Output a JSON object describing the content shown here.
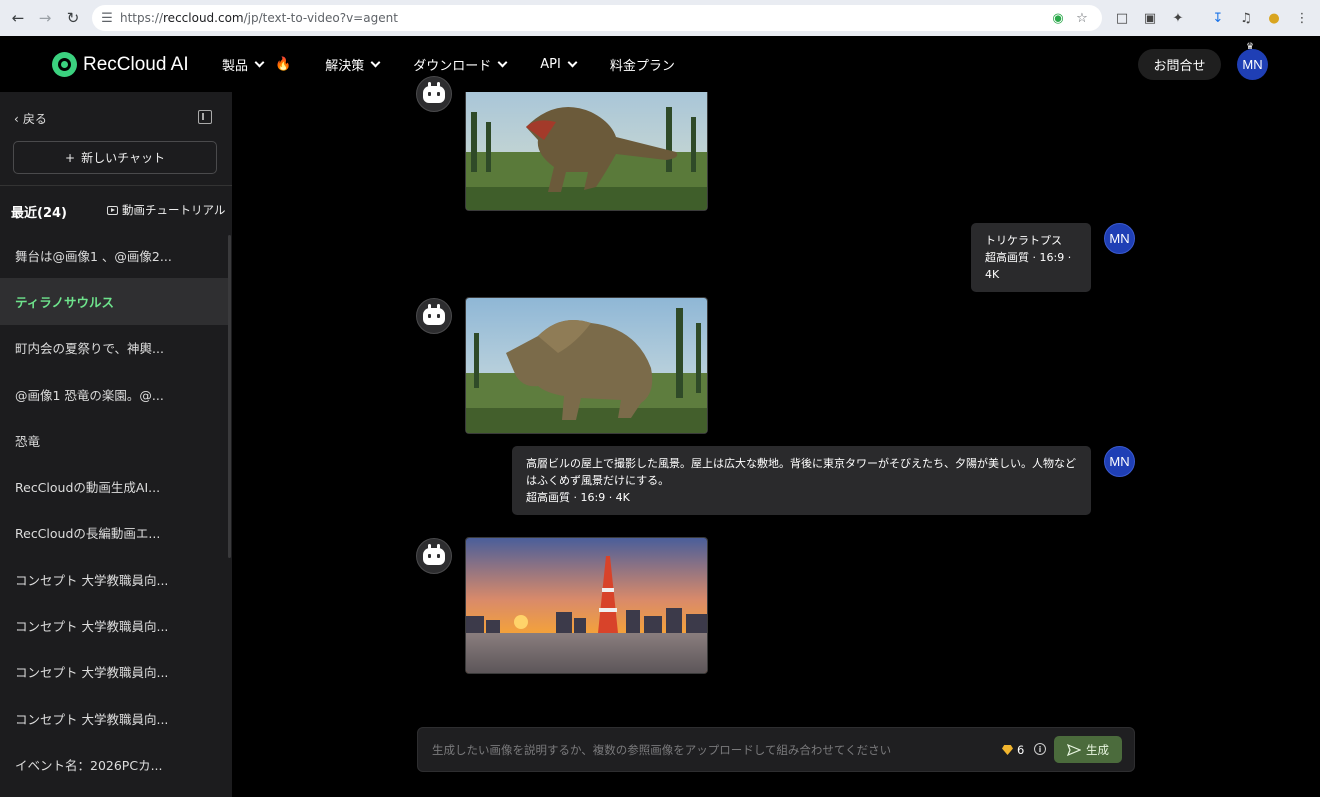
{
  "browser": {
    "url_prefix": "https://",
    "url_host": "reccloud.com",
    "url_path": "/jp/text-to-video?v=agent"
  },
  "header": {
    "logo_text": "RecCloud AI",
    "menu": [
      "製品",
      "解決策",
      "ダウンロード",
      "API",
      "料金プラン"
    ],
    "contact_label": "お問合せ",
    "avatar_initials": "MN"
  },
  "sidebar": {
    "back_label": "戻る",
    "new_chat_label": "新しいチャット",
    "recent_label": "最近(24)",
    "tutorial_label": "動画チュートリアル",
    "items": [
      "舞台は@画像1 、@画像2...",
      "ティラノサウルス",
      "町内会の夏祭りで、神輿...",
      "@画像1 恐竜の楽園。@...",
      "恐竜",
      "RecCloudの動画生成AI...",
      "RecCloudの長編動画エ...",
      "コンセプト 大学教職員向...",
      "コンセプト 大学教職員向...",
      "コンセプト 大学教職員向...",
      "コンセプト 大学教職員向...",
      "イベント名：2026PCカ..."
    ],
    "active_index": 1
  },
  "chat": {
    "user_initials": "MN",
    "msg1_text": "トリケラトプス",
    "msg1_meta": "超高画質 · 16:9 · 4K",
    "msg2_text": "高層ビルの屋上で撮影した風景。屋上は広大な敷地。背後に東京タワーがそびえたち、夕陽が美しい。人物などはふくめず風景だけにする。",
    "msg2_meta": "超高画質 · 16:9 · 4K"
  },
  "input": {
    "placeholder": "生成したい画像を説明するか、複数の参照画像をアップロードして組み合わせてください",
    "credits": "6",
    "generate_label": "生成"
  },
  "colors": {
    "accent_green": "#6ee38c",
    "avatar_blue": "#1f3fb5",
    "generate_bg": "#4b6b3c"
  }
}
